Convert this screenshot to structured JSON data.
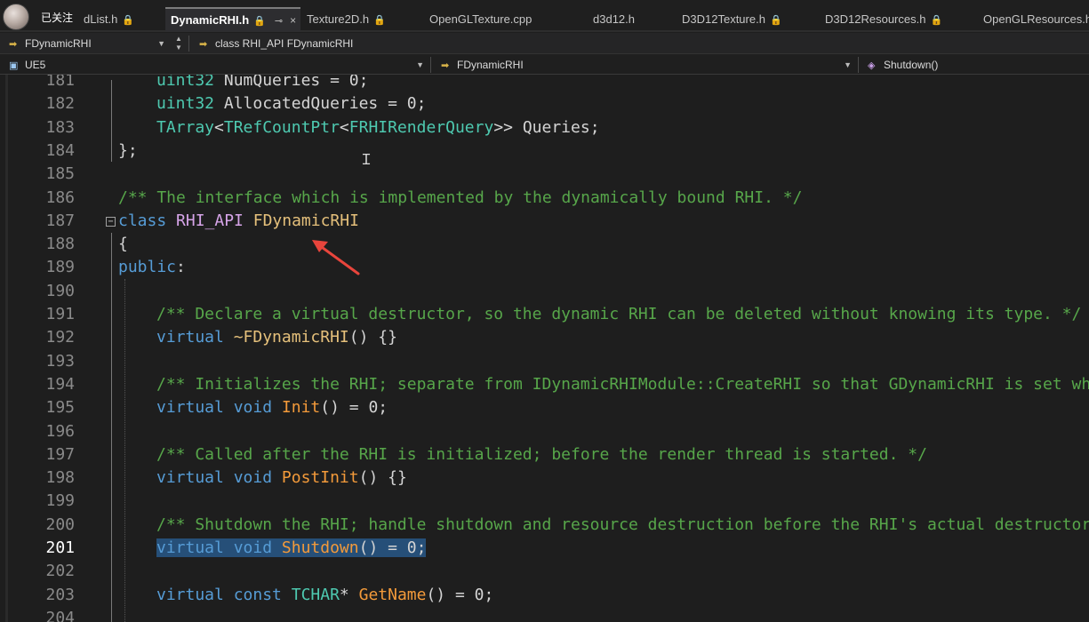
{
  "tabs": [
    {
      "label": "dList.h",
      "lock": "🔒",
      "active": false
    },
    {
      "label": "DynamicRHI.h",
      "lock": "🔒",
      "active": true,
      "pin": "⊸",
      "close": "×"
    },
    {
      "label": "Texture2D.h",
      "lock": "🔒",
      "active": false
    },
    {
      "label": "OpenGLTexture.cpp",
      "lock": "",
      "active": false
    },
    {
      "label": "d3d12.h",
      "lock": "",
      "active": false
    },
    {
      "label": "D3D12Texture.h",
      "lock": "🔒",
      "active": false
    },
    {
      "label": "D3D12Resources.h",
      "lock": "🔒",
      "active": false
    },
    {
      "label": "OpenGLResources.h",
      "lock": "",
      "active": false
    }
  ],
  "overlay": {
    "follow_text": "已关注"
  },
  "nav1": {
    "scope": "FDynamicRHI",
    "member": "class RHI_API FDynamicRHI"
  },
  "nav2": {
    "project": "UE5",
    "class": "FDynamicRHI",
    "function": "Shutdown()"
  },
  "code_lines": [
    {
      "n": "181",
      "tokens": [
        [
          "t",
          "uint32"
        ],
        [
          "p",
          " NumQueries = 0;"
        ]
      ]
    },
    {
      "n": "182",
      "tokens": [
        [
          "t",
          "uint32"
        ],
        [
          "p",
          " AllocatedQueries = 0;"
        ]
      ]
    },
    {
      "n": "183",
      "tokens": [
        [
          "t",
          "TArray"
        ],
        [
          "p",
          "<"
        ],
        [
          "t",
          "TRefCountPtr"
        ],
        [
          "p",
          "<"
        ],
        [
          "t",
          "FRHIRenderQuery"
        ],
        [
          "p",
          ">> Queries;"
        ]
      ]
    },
    {
      "n": "184",
      "tokens": [
        [
          "p",
          "};"
        ]
      ]
    },
    {
      "n": "185",
      "tokens": []
    },
    {
      "n": "186",
      "tokens": [
        [
          "c",
          "/** The interface which is implemented by the dynamically bound RHI. */"
        ]
      ]
    },
    {
      "n": "187",
      "tokens": [
        [
          "k",
          "class"
        ],
        [
          "p",
          " "
        ],
        [
          "m",
          "RHI_API"
        ],
        [
          "p",
          " "
        ],
        [
          "tt",
          "FDynamicRHI"
        ]
      ]
    },
    {
      "n": "188",
      "tokens": [
        [
          "p",
          "{"
        ]
      ]
    },
    {
      "n": "189",
      "tokens": [
        [
          "k",
          "public"
        ],
        [
          "p",
          ":"
        ]
      ]
    },
    {
      "n": "190",
      "tokens": []
    },
    {
      "n": "191",
      "tokens": [
        [
          "c",
          "/** Declare a virtual destructor, so the dynamic RHI can be deleted without knowing its type. */"
        ]
      ]
    },
    {
      "n": "192",
      "tokens": [
        [
          "k",
          "virtual"
        ],
        [
          "p",
          " "
        ],
        [
          "tt",
          "~FDynamicRHI"
        ],
        [
          "p",
          "() {}"
        ]
      ]
    },
    {
      "n": "193",
      "tokens": []
    },
    {
      "n": "194",
      "tokens": [
        [
          "c",
          "/** Initializes the RHI; separate from IDynamicRHIModule::CreateRHI so that GDynamicRHI is set when"
        ]
      ]
    },
    {
      "n": "195",
      "tokens": [
        [
          "k",
          "virtual"
        ],
        [
          "p",
          " "
        ],
        [
          "k",
          "void"
        ],
        [
          "p",
          " "
        ],
        [
          "f",
          "Init"
        ],
        [
          "p",
          "() = 0;"
        ]
      ]
    },
    {
      "n": "196",
      "tokens": []
    },
    {
      "n": "197",
      "tokens": [
        [
          "c",
          "/** Called after the RHI is initialized; before the render thread is started. */"
        ]
      ]
    },
    {
      "n": "198",
      "tokens": [
        [
          "k",
          "virtual"
        ],
        [
          "p",
          " "
        ],
        [
          "k",
          "void"
        ],
        [
          "p",
          " "
        ],
        [
          "f",
          "PostInit"
        ],
        [
          "p",
          "() {}"
        ]
      ]
    },
    {
      "n": "199",
      "tokens": []
    },
    {
      "n": "200",
      "tokens": [
        [
          "c",
          "/** Shutdown the RHI; handle shutdown and resource destruction before the RHI's actual destructor is"
        ]
      ]
    },
    {
      "n": "201",
      "tokens": [
        [
          "k",
          "virtual"
        ],
        [
          "p",
          " "
        ],
        [
          "k",
          "void"
        ],
        [
          "p",
          " "
        ],
        [
          "f",
          "Shutdown"
        ],
        [
          "p",
          "() = 0;"
        ]
      ],
      "selected": true,
      "current": true
    },
    {
      "n": "202",
      "tokens": []
    },
    {
      "n": "203",
      "tokens": [
        [
          "k",
          "virtual"
        ],
        [
          "p",
          " "
        ],
        [
          "k",
          "const"
        ],
        [
          "p",
          " "
        ],
        [
          "t",
          "TCHAR"
        ],
        [
          "p",
          "* "
        ],
        [
          "f",
          "GetName"
        ],
        [
          "p",
          "() = 0;"
        ]
      ]
    },
    {
      "n": "204",
      "tokens": []
    }
  ],
  "colors": {
    "keyword": "#569cd6",
    "type": "#4ec9b0",
    "class_name": "#e5c07b",
    "function": "#f39a3a",
    "macro": "#d6a4e8",
    "comment": "#57a64a",
    "selection": "#264f78",
    "annotation_arrow": "#e8453c"
  },
  "annotation": {
    "shape": "red-arrow",
    "points_to": "FDynamicRHI"
  }
}
